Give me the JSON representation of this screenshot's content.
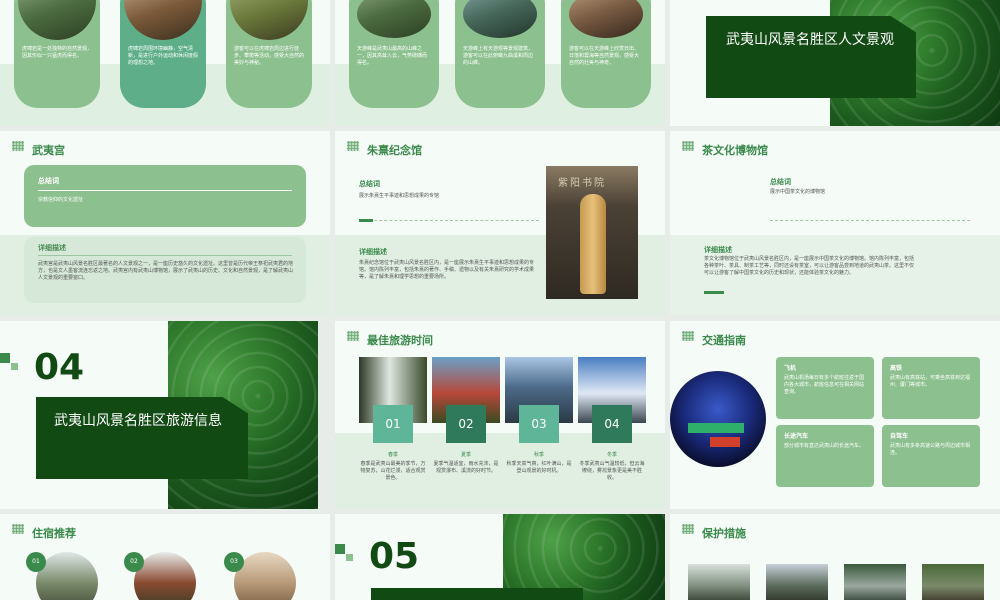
{
  "s1": {
    "cards": [
      {
        "text": "虎啸岩是一处独特的自然景观，因其形似一只猛虎而得名。"
      },
      {
        "text": "虎啸岩周围环境幽静，空气清新，是进行户外运动和休闲度假的理想之地。"
      },
      {
        "text": "游客可以在虎啸岩周边进行徒步、攀爬等活动，感受大自然的美妙与神秘。"
      }
    ]
  },
  "s2": {
    "cards": [
      {
        "text": "天游峰是武夷山最高的山峰之一，因其高耸入云，气势磅礴而得名。"
      },
      {
        "text": "天游峰上有天游观等景观建筑，游客可以在此俯瞰九曲溪和周边的山峰。"
      },
      {
        "text": "游客可以在天游峰上欣赏日出、日落和雲海等自然景观，感受大自然的壮美与神奇。"
      }
    ]
  },
  "s3": {
    "title": "武夷山风景名胜区人文景观"
  },
  "s4": {
    "heading": "武夷宫",
    "summary_label": "总结词",
    "summary_text": "宗教信仰的文化遗址",
    "detail_label": "详细描述",
    "detail_text": "武夷宫是武夷山风景名胜区最著名的人文景观之一，是一座历史悠久的文化遗址。这里曾是历代帝王祭祀武夷君的地方，也是文人墨客流连忘返之地。武夷宫内有武夷山博物馆，展示了武夷山的历史、文化和自然景观，是了解武夷山人文景观的重要窗口。"
  },
  "s5": {
    "heading": "朱熹纪念馆",
    "summary_label": "总结词",
    "summary_text": "展示朱熹生平事迹和思想成果的专馆",
    "detail_label": "详细描述",
    "detail_text": "朱熹纪念馆位于武夷山风景名胜区内，是一座展示朱熹生平事迹和思想成果的专馆。馆内陈列丰富，包括朱熹的著作、手稿、遗物以及有关朱熹研究的学术成果等，是了解朱熹和理学思想的重要场所。",
    "plaque": "紫阳书院"
  },
  "s6": {
    "heading": "茶文化博物馆",
    "summary_label": "总结词",
    "summary_text": "展示中国茶文化的博物馆",
    "detail_label": "详细描述",
    "detail_text": "茶文化博物馆位于武夷山风景名胜区内，是一座展示中国茶文化的博物馆。馆内陈列丰富，包括各种茶叶、茶具、制茶工艺等，同时还设有茶室，可以让游客品尝到地道的武夷山茶。这里不仅可以让游客了解中国茶文化的历史和现状，还能体验茶文化的魅力。"
  },
  "s7": {
    "num": "04",
    "title": "武夷山风景名胜区旅游信息"
  },
  "s8": {
    "heading": "最佳旅游时间",
    "seasons": [
      {
        "num": "01",
        "name": "春季",
        "text": "春季是武夷山最美的季节，万物复苏，山花烂漫，适合观赏景色。"
      },
      {
        "num": "02",
        "name": "夏季",
        "text": "夏季气温适宜，雨水充沛，是观赏瀑布、溪流的好时节。"
      },
      {
        "num": "03",
        "name": "秋季",
        "text": "秋季天高气爽，红叶满山，是登山观景的好时机。"
      },
      {
        "num": "04",
        "name": "冬季",
        "text": "冬季武夷山气温较低，但云海缭绕，雾凇景象更是美不胜收。"
      }
    ]
  },
  "s9": {
    "heading": "交通指南",
    "cards": [
      {
        "title": "飞机",
        "text": "武夷山机场每日有多个航班往返于国内各大城市，航班信息可在相关网站查询。"
      },
      {
        "title": "高铁",
        "text": "武夷山有高铁站，可乘坐高铁到达福州、厦门等城市。"
      },
      {
        "title": "长途汽车",
        "text": "部分城市有直达武夷山的长途汽车。"
      },
      {
        "title": "自驾车",
        "text": "武夷山有多条高速公路与周边城市相连。"
      }
    ]
  },
  "s10": {
    "heading": "住宿推荐",
    "nums": [
      "01",
      "02",
      "03"
    ]
  },
  "s11": {
    "num": "05"
  },
  "s12": {
    "heading": "保护措施"
  }
}
